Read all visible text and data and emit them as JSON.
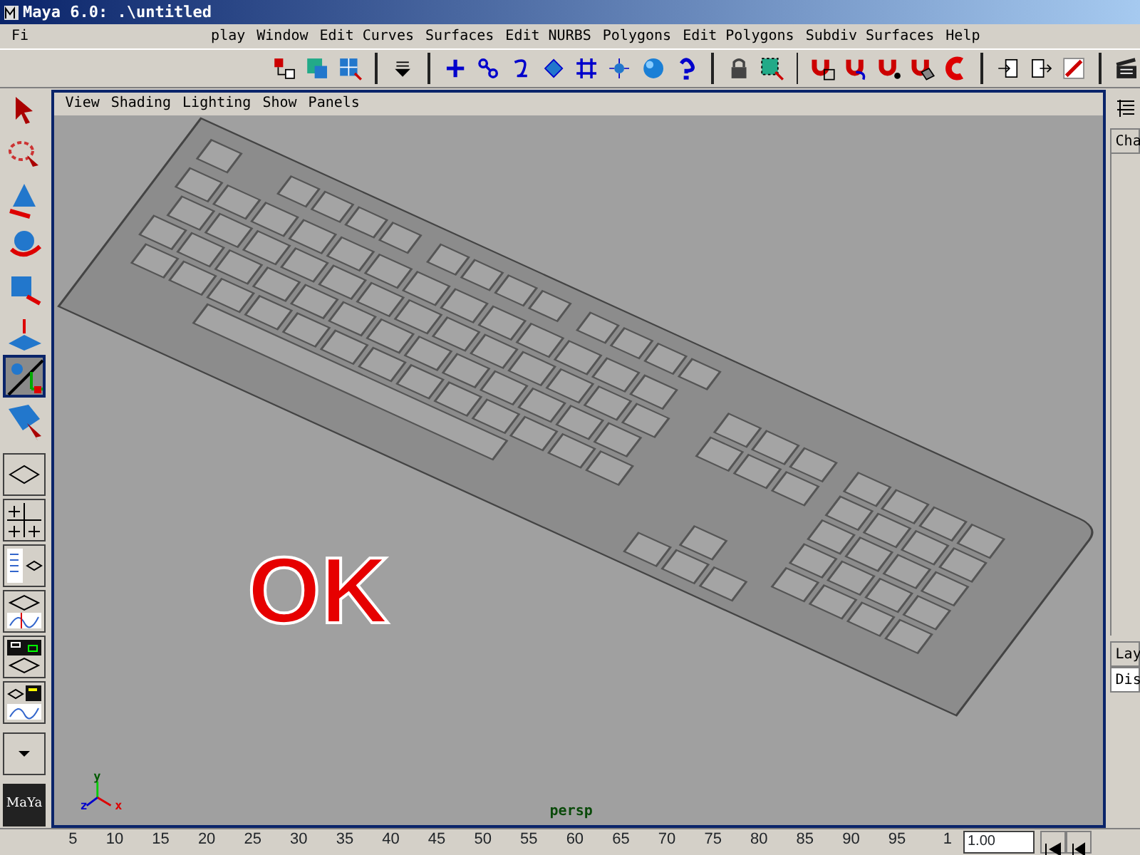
{
  "window": {
    "title": "Maya 6.0: .\\untitled"
  },
  "menus": [
    "Fi",
    "play",
    "Window",
    "Edit Curves",
    "Surfaces",
    "Edit NURBS",
    "Polygons",
    "Edit Polygons",
    "Subdiv Surfaces",
    "Help"
  ],
  "tools": [
    {
      "selected": false
    },
    {
      "selected": false
    },
    {
      "selected": false
    },
    {
      "selected": false
    },
    {
      "selected": false
    },
    {
      "selected": false
    },
    {
      "selected": true
    },
    {
      "selected": false
    }
  ],
  "panel_menus": [
    "View",
    "Shading",
    "Lighting",
    "Show",
    "Panels"
  ],
  "viewport": {
    "camera_label": "persp",
    "overlay_text": "OK",
    "axis_labels": [
      "y",
      "z",
      "x"
    ]
  },
  "logo": "MaYa",
  "right_panel": {
    "channel_tab": "Cha",
    "layer_tab": "Lay",
    "layer_field": "Dis"
  },
  "time_slider": {
    "ticks": [
      "5",
      "10",
      "15",
      "20",
      "25",
      "30",
      "35",
      "40",
      "45",
      "50",
      "55",
      "60",
      "65",
      "70",
      "75",
      "80",
      "85",
      "90",
      "95",
      "1"
    ],
    "current_time": "1.00"
  }
}
